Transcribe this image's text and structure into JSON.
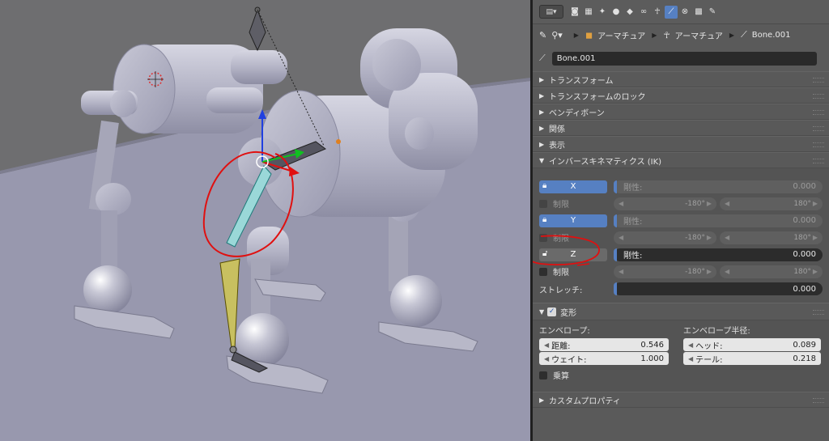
{
  "panel": {
    "breadcrumb": {
      "armature_object": "アーマチュア",
      "armature_data": "アーマチュア",
      "bone": "Bone.001"
    },
    "bone_name": "Bone.001",
    "sections": {
      "transform": "トランスフォーム",
      "transform_locks": "トランスフォームのロック",
      "bendy_bones": "ベンディボーン",
      "relations": "関係",
      "display": "表示",
      "ik": "インバースキネマティクス (IK)",
      "deform": "変形",
      "custom_props": "カスタムプロパティ"
    },
    "ik": {
      "stiffness_label": "剛性:",
      "limit_label": "制限",
      "axes": [
        {
          "axis": "X",
          "stiffness": "0.000",
          "min": "-180°",
          "max": "180°"
        },
        {
          "axis": "Y",
          "stiffness": "0.000",
          "min": "-180°",
          "max": "180°"
        },
        {
          "axis": "Z",
          "stiffness": "0.000",
          "min": "-180°",
          "max": "180°"
        }
      ],
      "stretch_label": "ストレッチ:",
      "stretch_value": "0.000"
    },
    "deform": {
      "envelope_label": "エンベロープ:",
      "distance_label": "距離:",
      "distance_value": "0.546",
      "weight_label": "ウェイト:",
      "weight_value": "1.000",
      "radius_label": "エンベロープ半径:",
      "head_label": "ヘッド:",
      "head_value": "0.089",
      "tail_label": "テール:",
      "tail_value": "0.218",
      "multiply_label": "乗算"
    }
  },
  "colors": {
    "accent": "#5680c2",
    "annotation": "#e01010",
    "bone_selected": "#c8c060"
  },
  "icons": [
    "editor-type-icon",
    "pin-icon",
    "armature-object-icon",
    "armature-data-icon",
    "bone-icon",
    "lock-icon",
    "checkbox-icon"
  ]
}
